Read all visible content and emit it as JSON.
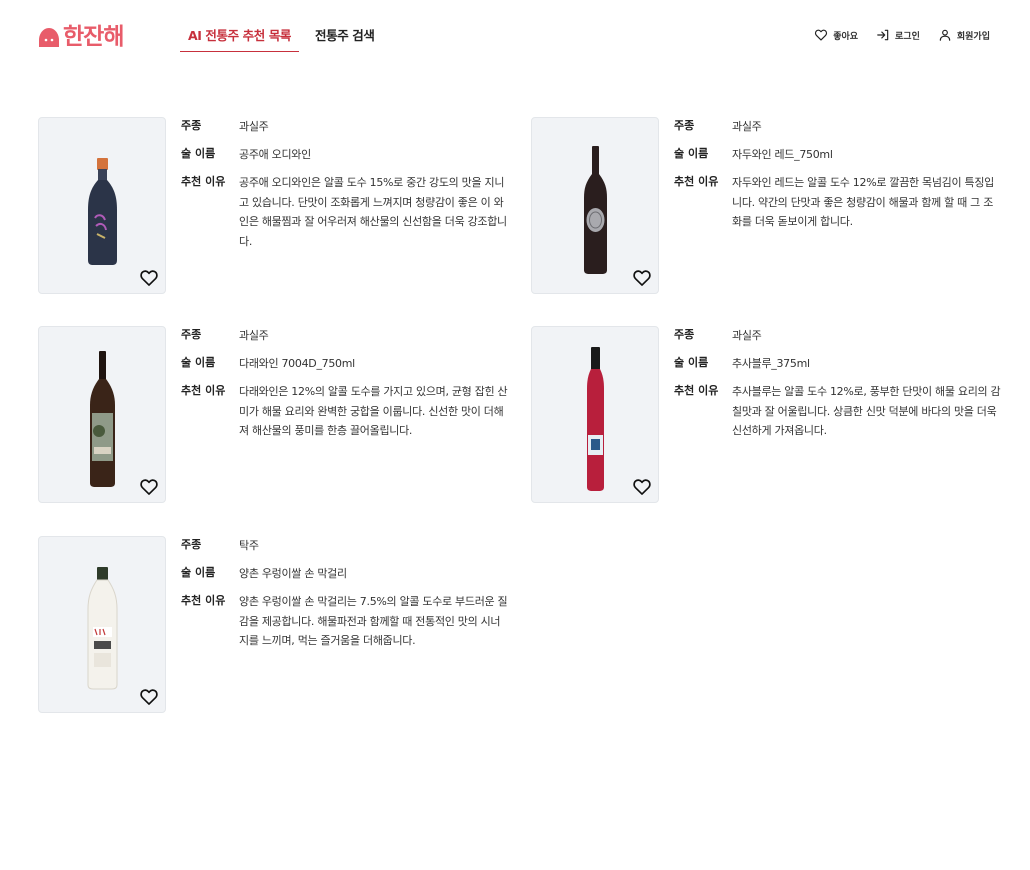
{
  "header": {
    "logo_text": "한잔해",
    "tabs": [
      {
        "label": "AI 전통주 추천 목록",
        "active": true
      },
      {
        "label": "전통주 검색",
        "active": false
      }
    ],
    "actions": {
      "like": "좋아요",
      "login": "로그인",
      "signup": "회원가입"
    }
  },
  "labels": {
    "type": "주종",
    "name": "술 이름",
    "reason": "추천 이유"
  },
  "items": [
    {
      "type": "과실주",
      "name": "공주애 오디와인",
      "reason": "공주애 오디와인은 알콜 도수 15%로 중간 강도의 맛을 지니고 있습니다. 단맛이 조화롭게 느껴지며 청량감이 좋은 이 와인은 해물찜과 잘 어우러져 해산물의 신선함을 더욱 강조합니다.",
      "bottle_color": "#2b3448"
    },
    {
      "type": "과실주",
      "name": "자두와인 레드_750ml",
      "reason": "자두와인 레드는 알콜 도수 12%로 깔끔한 목넘김이 특징입니다. 약간의 단맛과 좋은 청량감이 해물과 함께 할 때 그 조화를 더욱 돋보이게 합니다.",
      "bottle_color": "#2a1e1e"
    },
    {
      "type": "과실주",
      "name": "다래와인 7004D_750ml",
      "reason": "다래와인은 12%의 알콜 도수를 가지고 있으며, 균형 잡힌 산미가 해물 요리와 완벽한 궁합을 이룹니다. 신선한 맛이 더해져 해산물의 풍미를 한층 끌어올립니다.",
      "bottle_color": "#3a2418"
    },
    {
      "type": "과실주",
      "name": "추사블루_375ml",
      "reason": "추사블루는 알콜 도수 12%로, 풍부한 단맛이 해물 요리의 감칠맛과 잘 어울립니다. 상큼한 신맛 덕분에 바다의 맛을 더욱 신선하게 가져옵니다.",
      "bottle_color": "#b81f3c"
    },
    {
      "type": "탁주",
      "name": "양촌 우렁이쌀 손 막걸리",
      "reason": "양촌 우렁이쌀 손 막걸리는 7.5%의 알콜 도수로 부드러운 질감을 제공합니다. 해물파전과 함께할 때 전통적인 맛의 시너지를 느끼며, 먹는 즐거움을 더해줍니다.",
      "bottle_color": "#f4f2ec"
    }
  ]
}
